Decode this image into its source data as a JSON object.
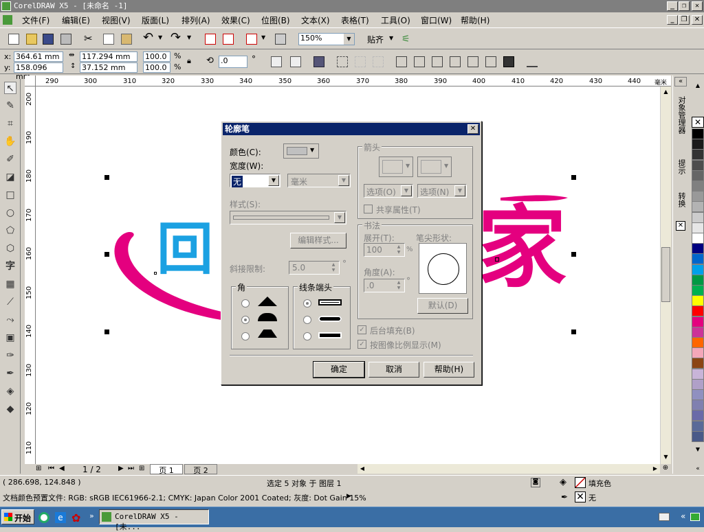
{
  "app": {
    "title": "CorelDRAW X5 - [未命名 -1]"
  },
  "menu": [
    "文件(F)",
    "编辑(E)",
    "视图(V)",
    "版面(L)",
    "排列(A)",
    "效果(C)",
    "位图(B)",
    "文本(X)",
    "表格(T)",
    "工具(O)",
    "窗口(W)",
    "帮助(H)"
  ],
  "toolbar": {
    "zoom": "150%",
    "snap": "贴齐"
  },
  "propbar": {
    "x": "364.61 mm",
    "y": "158.096 mm",
    "w": "117.294 mm",
    "h": "37.152 mm",
    "sx": "100.0",
    "sy": "100.0",
    "pct": "%",
    "rotate": ".0",
    "deg": "°"
  },
  "ruler_h": [
    "290",
    "300",
    "310",
    "320",
    "330",
    "340",
    "350",
    "360",
    "370",
    "380",
    "390",
    "400",
    "410",
    "420",
    "430",
    "440"
  ],
  "ruler_h_unit": "毫米",
  "ruler_v": [
    "200",
    "190",
    "180",
    "170",
    "160",
    "150",
    "140",
    "130",
    "120",
    "110"
  ],
  "ruler_v_unit": "毫米",
  "canvas": {
    "char1": "回",
    "char2": "家"
  },
  "pagenav": {
    "counter": "1 / 2",
    "tab1": "页 1",
    "tab2": "页 2"
  },
  "docker": {
    "tab1": "对象管理器",
    "tab2": "提示",
    "tab3": "转换"
  },
  "dialog": {
    "title": "轮廓笔",
    "color_label": "颜色(C):",
    "width_label": "宽度(W):",
    "width_value": "无",
    "unit": "毫米",
    "style_label": "样式(S):",
    "edit_style": "编辑样式...",
    "miter_label": "斜接限制:",
    "miter_value": "5.0",
    "miter_unit": "°",
    "corner_title": "角",
    "linecap_title": "线条端头",
    "arrows_title": "箭头",
    "option1": "选项(O)",
    "option2": "选项(N)",
    "share_attr": "共享属性(T)",
    "calligraphy_title": "书法",
    "stretch_label": "展开(T):",
    "stretch_value": "100",
    "stretch_unit": "%",
    "nib_label": "笔尖形状:",
    "angle_label": "角度(A):",
    "angle_value": ".0",
    "angle_unit": "°",
    "default_btn": "默认(D)",
    "behind_fill": "后台填充(B)",
    "scale_with_image": "按图像比例显示(M)",
    "ok": "确定",
    "cancel": "取消",
    "help": "帮助(H)"
  },
  "status": {
    "coords": "( 286.698, 124.848 )",
    "selection": "选定 5 对象 于 图层 1",
    "profile": "文档颜色预置文件: RGB: sRGB IEC61966-2.1; CMYK: Japan Color 2001 Coated; 灰度: Dot Gain 15%",
    "fill_label": "填充色",
    "outline_label": "无"
  },
  "taskbar": {
    "start": "开始",
    "task": "CorelDRAW X5 - [未..."
  },
  "palette": [
    "#000000",
    "#1a1a1a",
    "#333333",
    "#4d4d4d",
    "#666666",
    "#808080",
    "#999999",
    "#b3b3b3",
    "#cccccc",
    "#e6e6e6",
    "#ffffff",
    "#000080",
    "#0066cc",
    "#00a0e9",
    "#009944",
    "#00b050",
    "#ffff00",
    "#ff0000",
    "#e4007f",
    "#cc3399",
    "#ff6600",
    "#f4a7b9",
    "#8b4513",
    "#c8b4d8",
    "#b0a0c8",
    "#9090c0",
    "#8080b0",
    "#6a6aa8",
    "#5a6a98",
    "#4a5a88"
  ]
}
